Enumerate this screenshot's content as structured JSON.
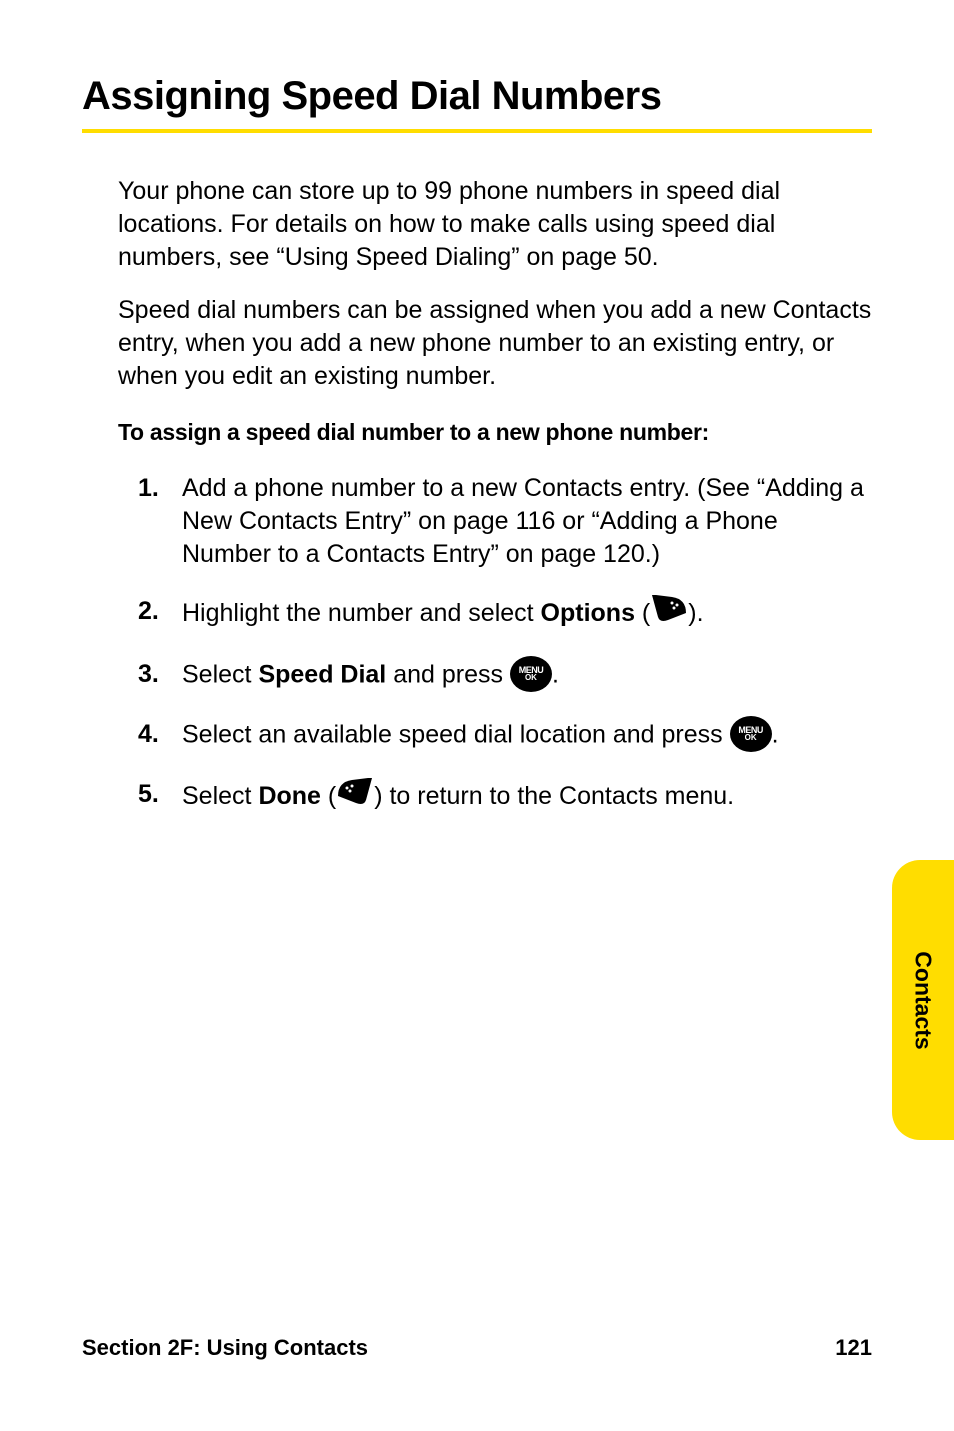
{
  "heading": "Assigning Speed Dial Numbers",
  "para1": "Your phone can store up to 99 phone numbers in speed dial locations. For details on how to make calls using speed dial numbers, see “Using Speed Dialing” on page 50.",
  "para2": "Speed dial numbers can be assigned when you add a new Contacts entry, when you add a new phone number to an existing entry, or when you edit an existing number.",
  "subhead": "To assign a speed dial number to a new phone number:",
  "steps": {
    "s1": {
      "num": "1.",
      "text_a": "Add a phone number to a new Contacts entry. (See “Adding a New Contacts Entry” on page 116 or “Adding a Phone Number to a Contacts Entry” on page 120.)"
    },
    "s2": {
      "num": "2.",
      "text_a": "Highlight the number and select ",
      "bold": "Options",
      "text_b": " (",
      "text_c": ")."
    },
    "s3": {
      "num": "3.",
      "text_a": "Select ",
      "bold": "Speed Dial",
      "text_b": " and press ",
      "text_c": "."
    },
    "s4": {
      "num": "4.",
      "text_a": "Select an available speed dial location and press ",
      "text_b": "."
    },
    "s5": {
      "num": "5.",
      "text_a": "Select ",
      "bold": "Done",
      "text_b": " (",
      "text_c": ") to return to the Contacts menu."
    }
  },
  "icons": {
    "menu_top": "MENU",
    "menu_bot": "OK"
  },
  "side_tab": "Contacts",
  "footer": {
    "left": "Section 2F: Using Contacts",
    "right": "121"
  }
}
